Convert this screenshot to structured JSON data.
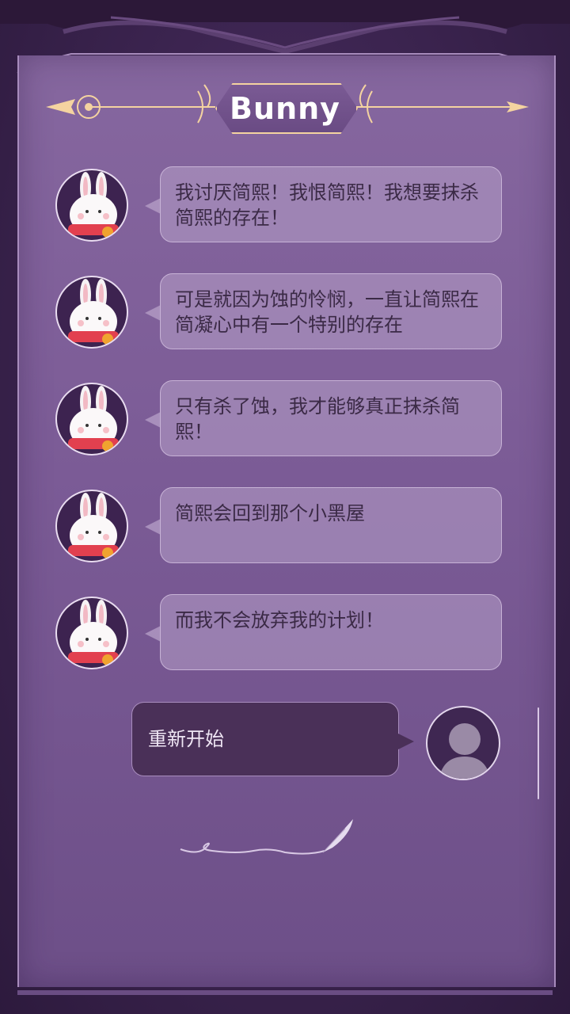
{
  "header": {
    "title": "Bunny"
  },
  "messages": [
    {
      "text": "我讨厌简熙！我恨简熙！我想要抹杀简熙的存在！"
    },
    {
      "text": "可是就因为蚀的怜悯，一直让简熙在简凝心中有一个特别的存在"
    },
    {
      "text": "只有杀了蚀，我才能够真正抹杀简熙！"
    },
    {
      "text": "简熙会回到那个小黑屋"
    },
    {
      "text": "而我不会放弃我的计划！"
    }
  ],
  "reply": {
    "label": "重新开始"
  },
  "colors": {
    "accent": "#f4d3a0",
    "panel": "#7b5b96",
    "frame": "#3a2450"
  }
}
